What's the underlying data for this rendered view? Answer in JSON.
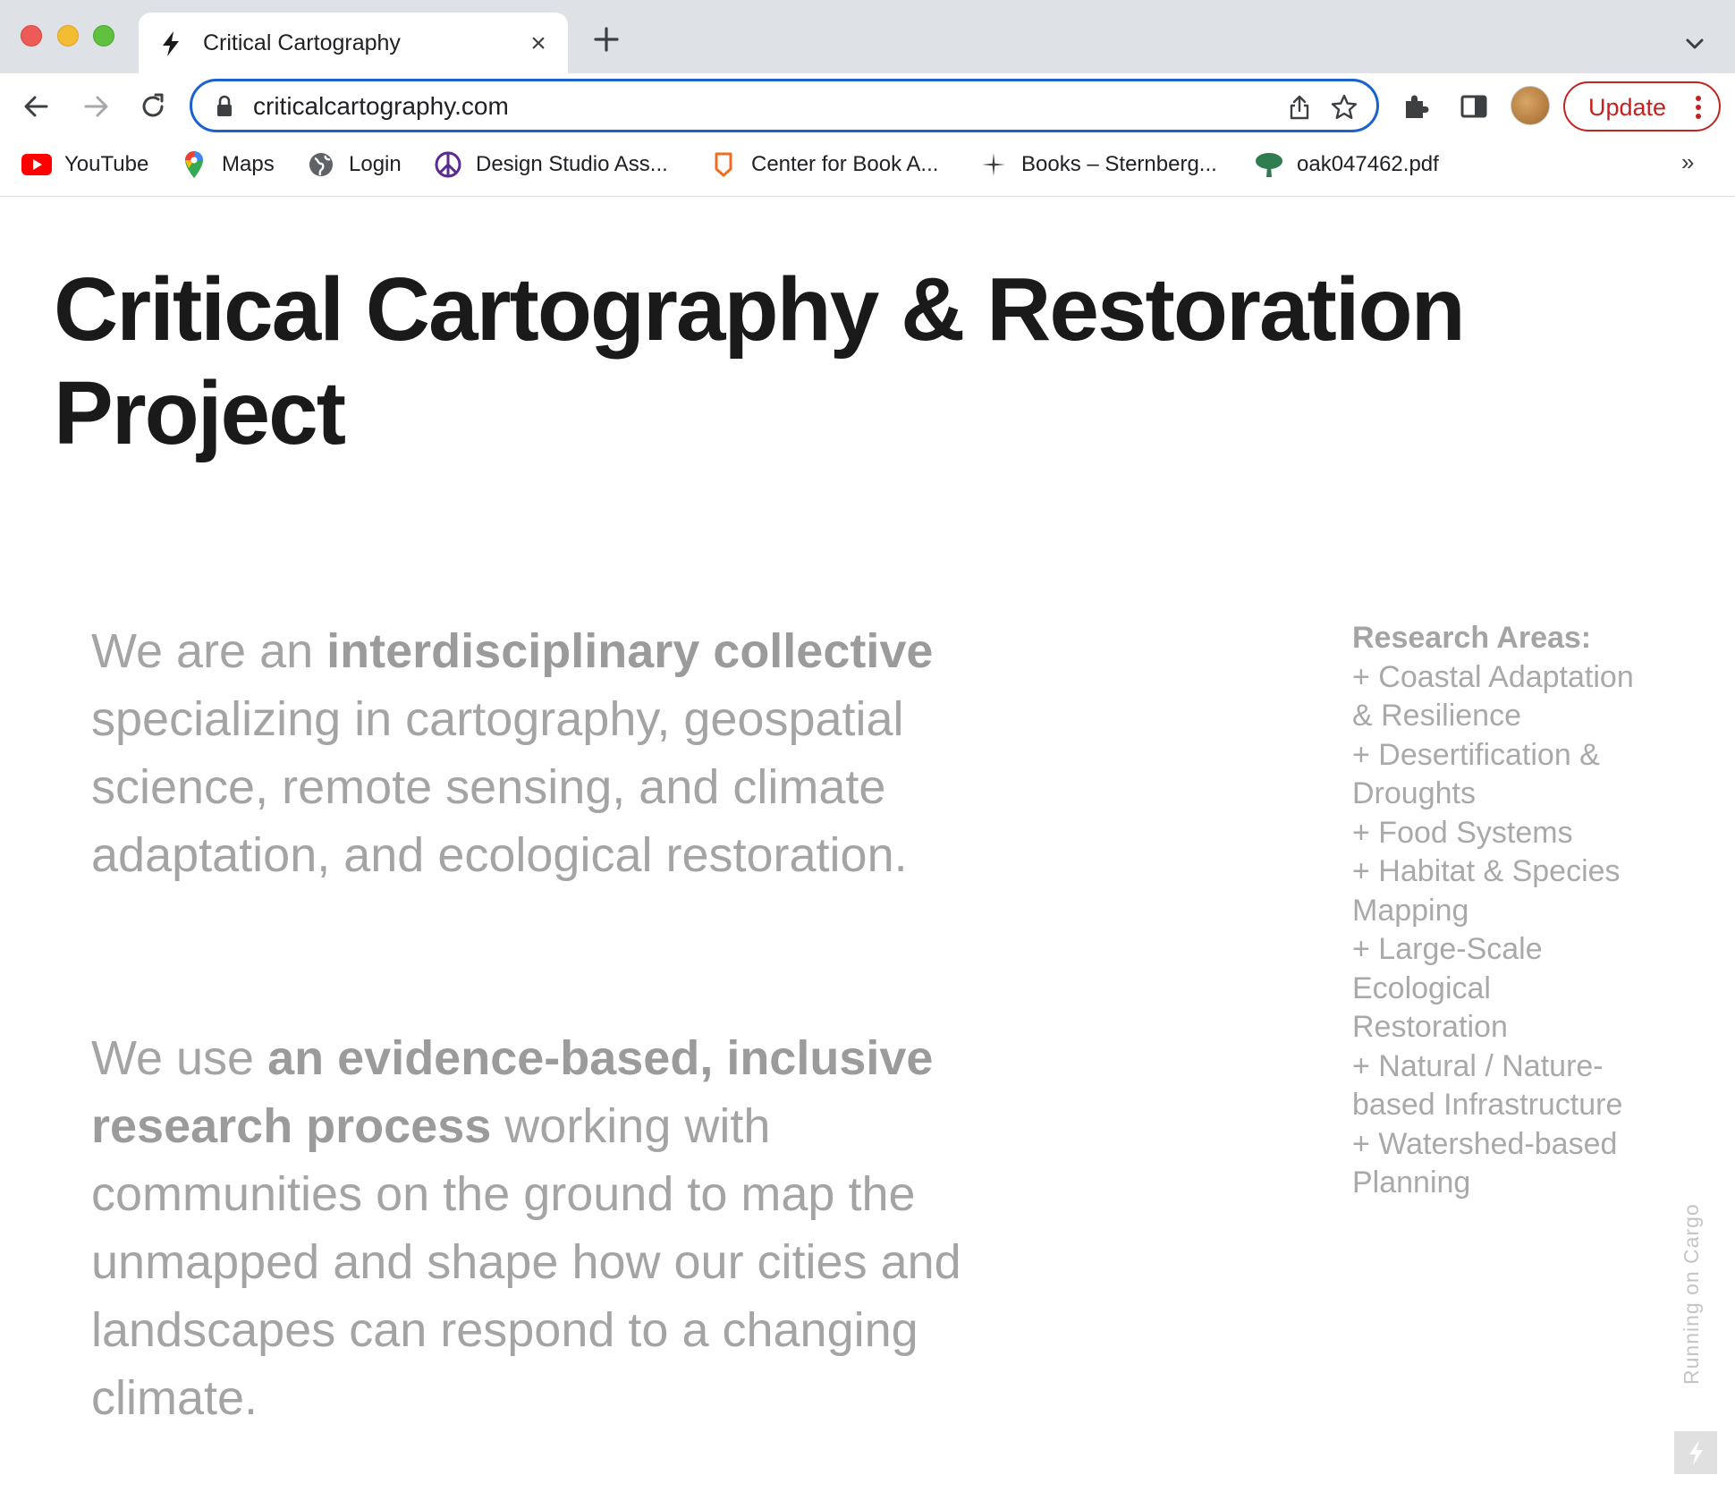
{
  "browser": {
    "tab": {
      "title": "Critical Cartography",
      "favicon": "bolt-icon",
      "close": "×"
    },
    "new_tab_icon": "plus-icon",
    "url": "criticalcartography.com",
    "update_label": "Update",
    "bookmarks": [
      {
        "label": "YouTube",
        "icon": "youtube-icon"
      },
      {
        "label": "Maps",
        "icon": "maps-pin-icon"
      },
      {
        "label": "Login",
        "icon": "globe-icon"
      },
      {
        "label": "Design Studio Ass...",
        "icon": "peace-icon"
      },
      {
        "label": "Center for Book A...",
        "icon": "book-arts-icon"
      },
      {
        "label": "Books – Sternberg...",
        "icon": "star-burst-icon"
      },
      {
        "label": "oak047462.pdf",
        "icon": "tree-icon"
      }
    ],
    "bookmarks_more": "»",
    "colors": {
      "accent": "#1a62d0",
      "update": "#c5221f"
    }
  },
  "page": {
    "title": "Critical Cartography & Restoration Project",
    "intro_1": {
      "lead": "We are an ",
      "bold": "interdisciplinary collective",
      "rest": " specializing in cartography, geospatial science, remote sensing, and climate adaptation, and ecological restoration."
    },
    "intro_2": {
      "lead": "We use ",
      "bold": "an evidence-based, inclusive research process",
      "rest": " working with communities on the ground to map the unmapped and shape how our cities and landscapes can respond to a changing climate."
    },
    "research": {
      "heading": "Research Areas:",
      "items": [
        "+ Coastal Adaptation & Resilience",
        "+ Desertification & Droughts",
        "+ Food Systems",
        "+ Habitat & Species Mapping",
        "+ Large-Scale Ecological Restoration",
        "+ Natural / Nature-based Infrastructure",
        "+ Watershed-based Planning"
      ]
    },
    "running_on": "Running on Cargo"
  }
}
